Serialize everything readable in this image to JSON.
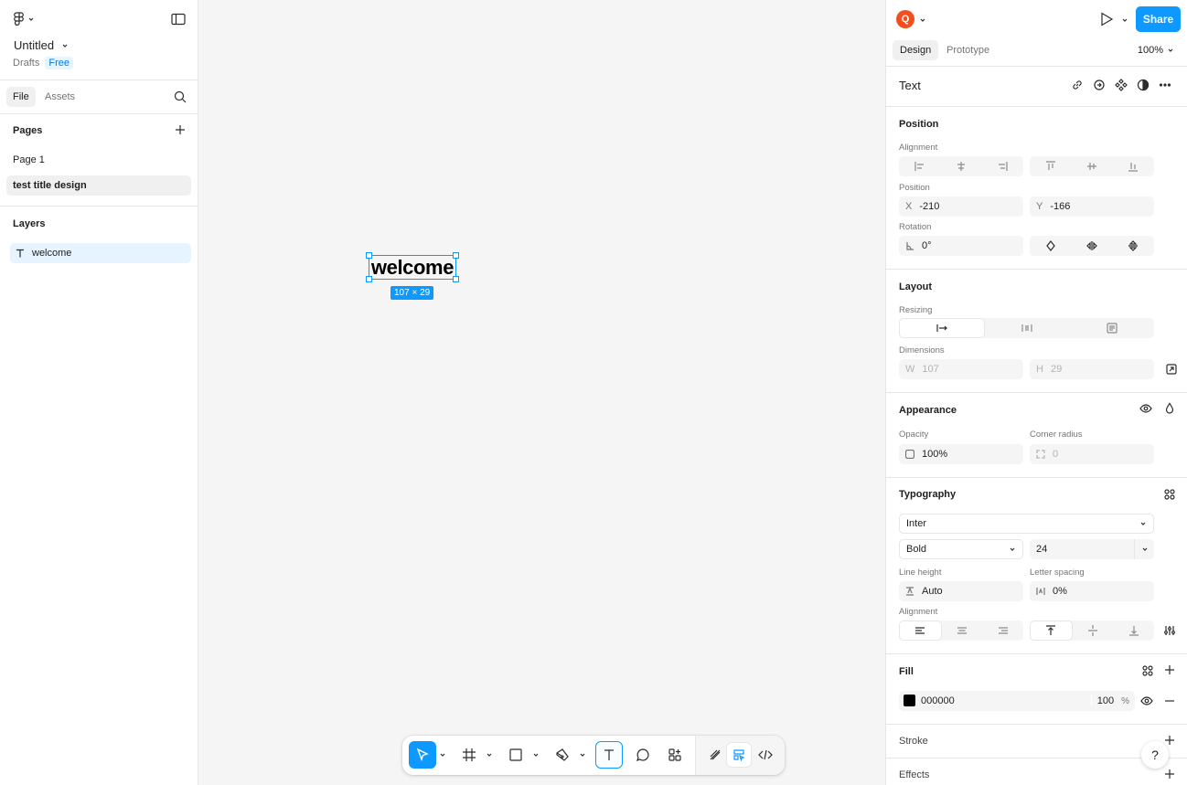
{
  "file": {
    "title": "Untitled",
    "location": "Drafts",
    "plan_badge": "Free"
  },
  "left_tabs": {
    "file": "File",
    "assets": "Assets"
  },
  "pages": {
    "header": "Pages",
    "items": [
      "Page 1",
      "test  title design"
    ]
  },
  "layers": {
    "header": "Layers",
    "items": [
      {
        "name": "welcome",
        "type": "text"
      }
    ]
  },
  "canvas": {
    "selected_text": "welcome",
    "size_label": "107 × 29"
  },
  "header": {
    "avatar_initial": "Q",
    "avatar_color": "#f24e1e",
    "share_label": "Share",
    "accent": "#0d99ff"
  },
  "right_tabs": {
    "design": "Design",
    "prototype": "Prototype",
    "zoom": "100%"
  },
  "selection": {
    "type_label": "Text"
  },
  "position": {
    "section": "Position",
    "alignment_label": "Alignment",
    "position_label": "Position",
    "x_prefix": "X",
    "x": "-210",
    "y_prefix": "Y",
    "y": "-166",
    "rotation_label": "Rotation",
    "rotation": "0°"
  },
  "layout": {
    "section": "Layout",
    "resizing_label": "Resizing",
    "dimensions_label": "Dimensions",
    "w_prefix": "W",
    "w": "107",
    "h_prefix": "H",
    "h": "29"
  },
  "appearance": {
    "section": "Appearance",
    "opacity_label": "Opacity",
    "opacity": "100%",
    "radius_label": "Corner radius",
    "radius": "0"
  },
  "typography": {
    "section": "Typography",
    "font_family": "Inter",
    "font_weight": "Bold",
    "font_size": "24",
    "line_height_label": "Line height",
    "line_height": "Auto",
    "letter_spacing_label": "Letter spacing",
    "letter_spacing": "0%",
    "alignment_label": "Alignment"
  },
  "fill": {
    "section": "Fill",
    "hex": "000000",
    "swatch": "#000000",
    "opacity": "100",
    "unit": "%"
  },
  "stroke": {
    "section": "Stroke"
  },
  "effects": {
    "section": "Effects"
  },
  "help": "?"
}
